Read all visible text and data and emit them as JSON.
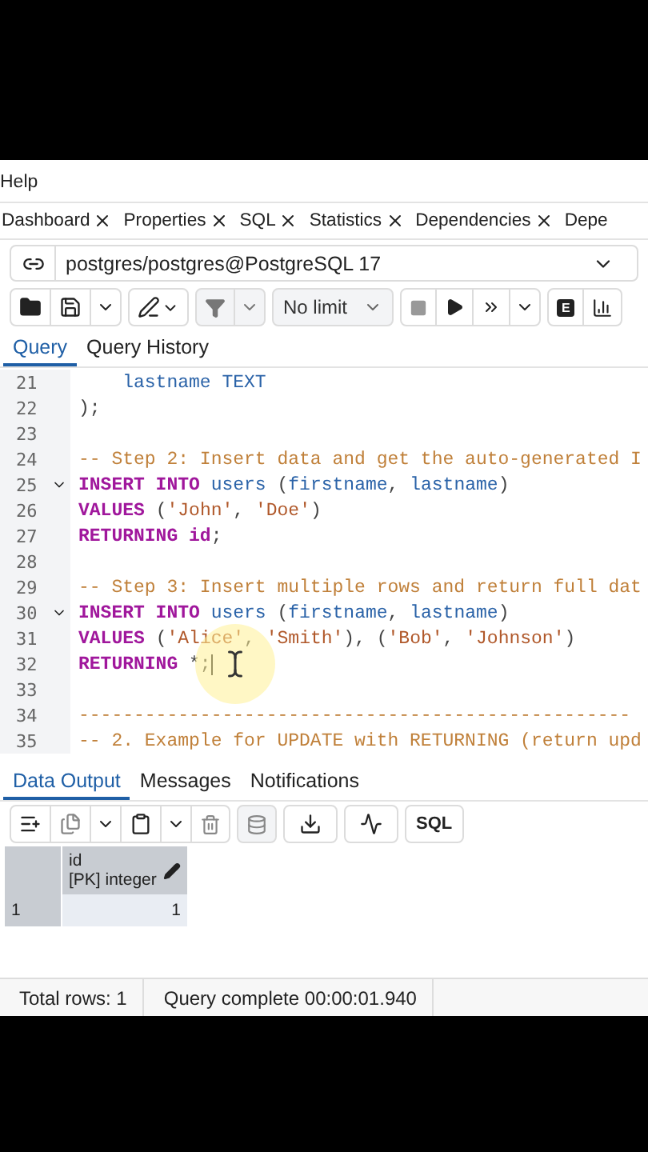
{
  "menu": [
    "Help"
  ],
  "panel_tabs": [
    {
      "label": "Dashboard",
      "closable": true
    },
    {
      "label": "Properties",
      "closable": true
    },
    {
      "label": "SQL",
      "closable": true
    },
    {
      "label": "Statistics",
      "closable": true
    },
    {
      "label": "Dependencies",
      "closable": true
    },
    {
      "label": "Depe",
      "closable": false
    }
  ],
  "connection": {
    "label": "postgres/postgres@PostgreSQL 17"
  },
  "toolbar": {
    "row_limit": "No limit",
    "explain_label": "E"
  },
  "editor_tabs": [
    {
      "label": "Query",
      "selected": true
    },
    {
      "label": "Query History",
      "selected": false
    }
  ],
  "code_lines": [
    {
      "number": "21",
      "fold": false,
      "caret": false,
      "tokens": [
        {
          "kind": "ident",
          "text": "    lastname TEXT"
        }
      ]
    },
    {
      "number": "22",
      "fold": false,
      "caret": false,
      "tokens": [
        {
          "kind": "plain",
          "text": ");"
        }
      ]
    },
    {
      "number": "23",
      "fold": false,
      "caret": false
    },
    {
      "number": "24",
      "fold": false,
      "caret": false,
      "tokens": [
        {
          "kind": "comment",
          "text": "-- Step 2: Insert data and get the auto-generated I"
        }
      ]
    },
    {
      "number": "25",
      "fold": true,
      "caret": false,
      "tokens": [
        {
          "kind": "keyword",
          "text": "INSERT INTO"
        },
        {
          "kind": "ident",
          "text": " users"
        },
        {
          "kind": "plain",
          "text": " ("
        },
        {
          "kind": "ident",
          "text": "firstname"
        },
        {
          "kind": "plain",
          "text": ", "
        },
        {
          "kind": "ident",
          "text": "lastname"
        },
        {
          "kind": "plain",
          "text": ")"
        }
      ]
    },
    {
      "number": "26",
      "fold": false,
      "caret": false,
      "tokens": [
        {
          "kind": "keyword",
          "text": "VALUES"
        },
        {
          "kind": "plain",
          "text": " ("
        },
        {
          "kind": "string",
          "text": "'John'"
        },
        {
          "kind": "plain",
          "text": ", "
        },
        {
          "kind": "string",
          "text": "'Doe'"
        },
        {
          "kind": "plain",
          "text": ")"
        }
      ]
    },
    {
      "number": "27",
      "fold": false,
      "caret": false,
      "tokens": [
        {
          "kind": "keyword",
          "text": "RETURNING id"
        },
        {
          "kind": "plain",
          "text": ";"
        }
      ]
    },
    {
      "number": "28",
      "fold": false,
      "caret": false
    },
    {
      "number": "29",
      "fold": false,
      "caret": false,
      "tokens": [
        {
          "kind": "comment",
          "text": "-- Step 3: Insert multiple rows and return full dat"
        }
      ]
    },
    {
      "number": "30",
      "fold": true,
      "caret": false,
      "tokens": [
        {
          "kind": "keyword",
          "text": "INSERT INTO"
        },
        {
          "kind": "ident",
          "text": " users"
        },
        {
          "kind": "plain",
          "text": " ("
        },
        {
          "kind": "ident",
          "text": "firstname"
        },
        {
          "kind": "plain",
          "text": ", "
        },
        {
          "kind": "ident",
          "text": "lastname"
        },
        {
          "kind": "plain",
          "text": ")"
        }
      ]
    },
    {
      "number": "31",
      "fold": false,
      "caret": false,
      "tokens": [
        {
          "kind": "keyword",
          "text": "VALUES"
        },
        {
          "kind": "plain",
          "text": " ("
        },
        {
          "kind": "string",
          "text": "'Alice'"
        },
        {
          "kind": "plain",
          "text": ", "
        },
        {
          "kind": "string",
          "text": "'Smith'"
        },
        {
          "kind": "plain",
          "text": "), ("
        },
        {
          "kind": "string",
          "text": "'Bob'"
        },
        {
          "kind": "plain",
          "text": ", "
        },
        {
          "kind": "string",
          "text": "'Johnson'"
        },
        {
          "kind": "plain",
          "text": ")"
        }
      ]
    },
    {
      "number": "32",
      "fold": false,
      "caret": true,
      "tokens": [
        {
          "kind": "keyword",
          "text": "RETURNING"
        },
        {
          "kind": "plain",
          "text": " *;"
        }
      ]
    },
    {
      "number": "33",
      "fold": false,
      "caret": false
    },
    {
      "number": "34",
      "fold": false,
      "caret": false,
      "tokens": [
        {
          "kind": "comment",
          "text": "--------------------------------------------------"
        }
      ]
    },
    {
      "number": "35",
      "fold": false,
      "caret": false,
      "tokens": [
        {
          "kind": "comment",
          "text": "-- 2. Example for UPDATE with RETURNING (return upd"
        }
      ]
    }
  ],
  "output_tabs": [
    {
      "label": "Data Output",
      "selected": true
    },
    {
      "label": "Messages",
      "selected": false
    },
    {
      "label": "Notifications",
      "selected": false
    }
  ],
  "output_toolbar": {
    "sql_label": "SQL"
  },
  "grid": {
    "columns": [
      {
        "name": "id",
        "type": "[PK] integer",
        "editable": true
      }
    ],
    "rows": [
      {
        "number": "1",
        "cells": [
          "1"
        ]
      }
    ]
  },
  "status_bar": [
    "Total rows: 1",
    "Query complete 00:00:01.940"
  ]
}
